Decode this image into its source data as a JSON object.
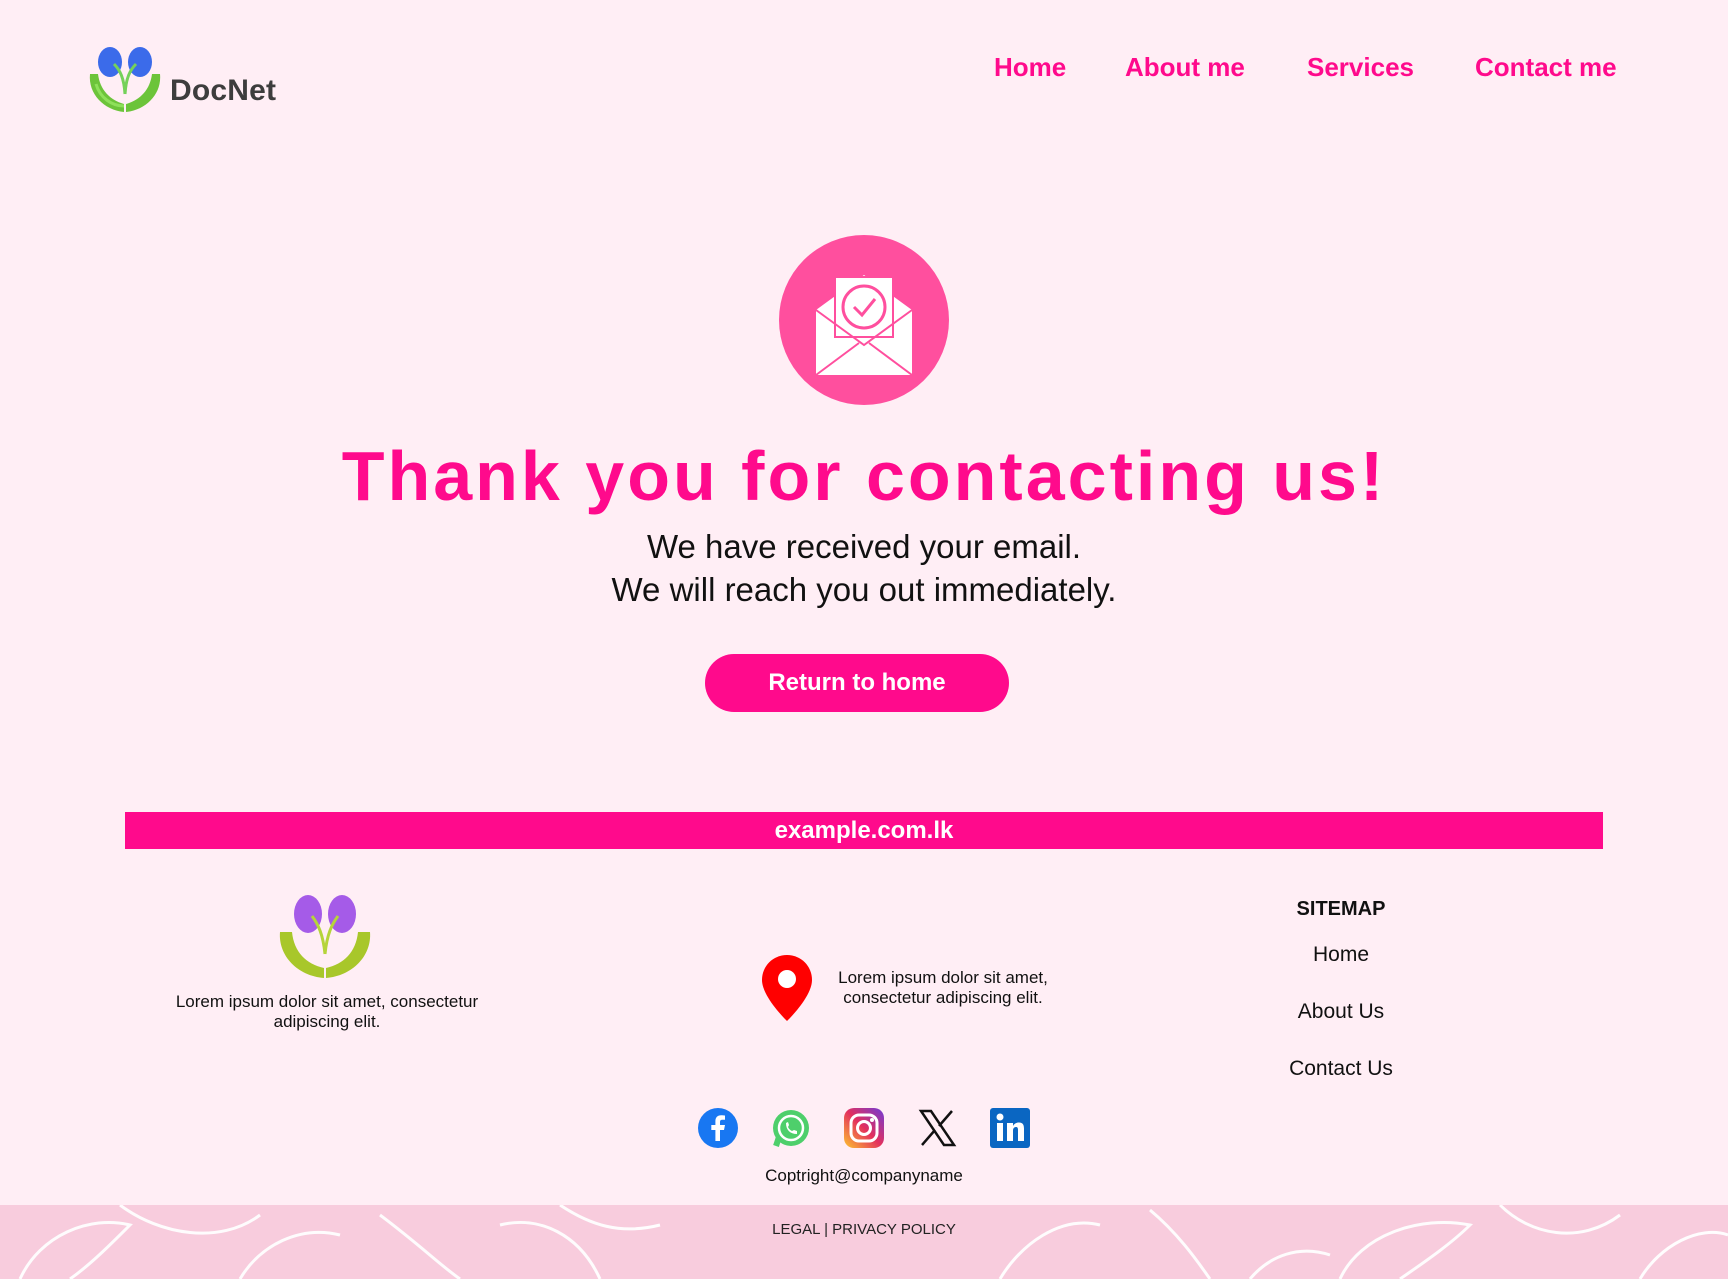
{
  "brand": {
    "name": "DocNet"
  },
  "nav": {
    "home": "Home",
    "about": "About me",
    "services": "Services",
    "contact": "Contact me"
  },
  "hero": {
    "icon": "envelope-check-icon",
    "title": "Thank you for contacting us!",
    "line1": "We have received your email.",
    "line2": "We will reach you out immediately.",
    "button": "Return to home"
  },
  "banner": {
    "text": "example.com.lk"
  },
  "footer": {
    "description": "Lorem ipsum dolor sit amet, consectetur adipiscing elit.",
    "address": "Lorem ipsum dolor sit amet, consectetur adipiscing elit.",
    "sitemap": {
      "title": "SITEMAP",
      "links": [
        "Home",
        "About Us",
        "Contact Us"
      ]
    },
    "social": [
      "facebook-icon",
      "whatsapp-icon",
      "instagram-icon",
      "x-icon",
      "linkedin-icon"
    ],
    "copyright": "Coptright@companyname",
    "legal": "LEGAL | PRIVACY POLICY"
  },
  "colors": {
    "accent": "#FF0A8C",
    "background": "#FFEEF5",
    "icon_circle": "#FF4F9E",
    "footer_bar": "#F8CCDD"
  }
}
